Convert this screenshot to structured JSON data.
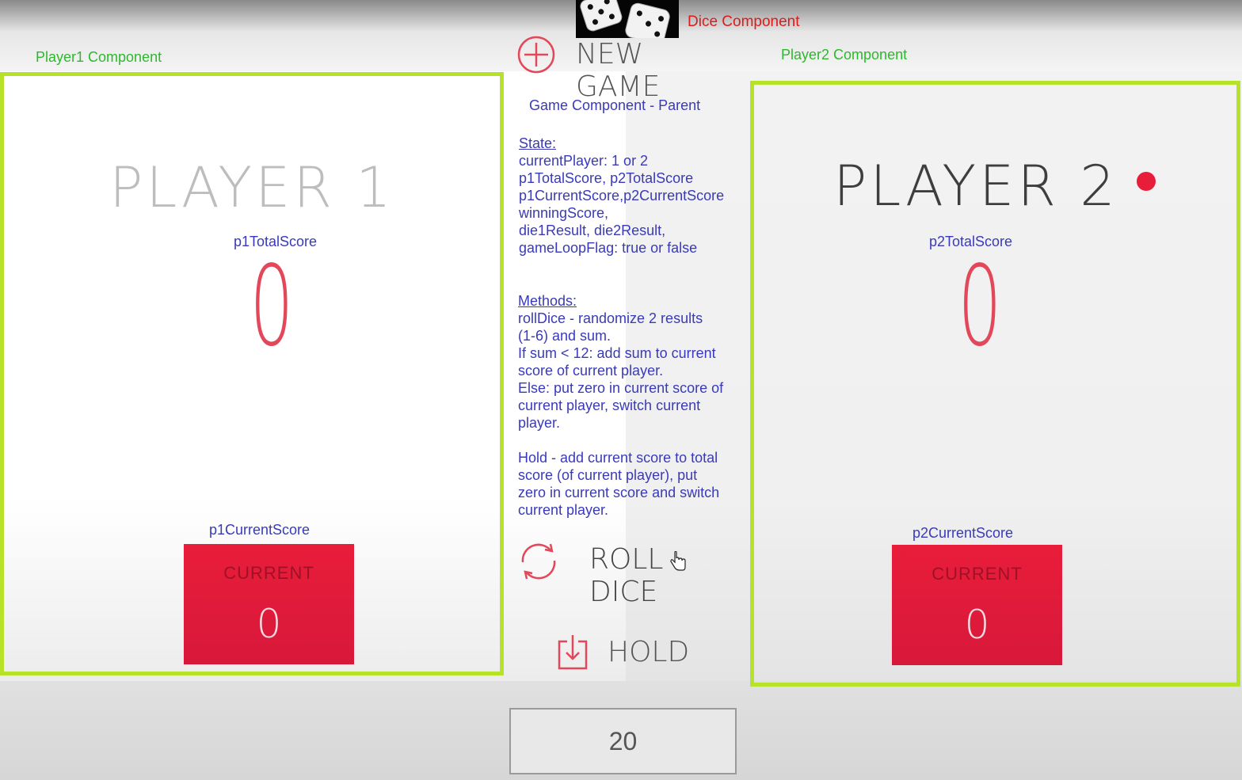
{
  "annotations": {
    "dice_component": "Dice Component",
    "player1_component": "Player1 Component",
    "player2_component": "Player2 Component",
    "game_component": "Game Component - Parent",
    "p1_total_score": "p1TotalScore",
    "p2_total_score": "p2TotalScore",
    "p1_current_score": "p1CurrentScore",
    "p2_current_score": "p2CurrentScore"
  },
  "state": {
    "heading": "State:",
    "lines": [
      "currentPlayer: 1 or 2",
      "p1TotalScore, p2TotalScore",
      "p1CurrentScore,p2CurrentScore",
      "winningScore,",
      "die1Result, die2Result,",
      "gameLoopFlag: true or false"
    ]
  },
  "methods": {
    "heading": "Methods:",
    "lines": [
      "rollDice - randomize 2 results",
      "(1-6) and sum.",
      "If sum < 12: add sum to current",
      "score of current player.",
      "Else: put zero in current score of",
      "current player, switch current",
      "player.",
      "",
      "Hold - add current score to total",
      "score (of current player), put",
      "zero in current score and switch",
      "current player."
    ]
  },
  "game": {
    "new_game_label": "NEW GAME",
    "roll_dice_label": "ROLL DICE",
    "hold_label": "HOLD",
    "winning_score_value": "20",
    "active_player": 2
  },
  "player1": {
    "name": "PLAYER 1",
    "total_score": "0",
    "current_label": "CURRENT",
    "current_score": "0"
  },
  "player2": {
    "name": "PLAYER 2",
    "total_score": "0",
    "current_label": "CURRENT",
    "current_score": "0"
  },
  "colors": {
    "accent_red": "#e81d3a",
    "annotation_green": "#2db82d",
    "annotation_blue": "#3a3ab8",
    "panel_outline": "#b6e22a"
  },
  "icons": {
    "dice": "dice-icon",
    "new_game": "plus-circle-icon",
    "roll_dice": "refresh-icon",
    "hold": "download-icon",
    "active_player": "active-dot-icon",
    "cursor": "hand-cursor-icon"
  }
}
